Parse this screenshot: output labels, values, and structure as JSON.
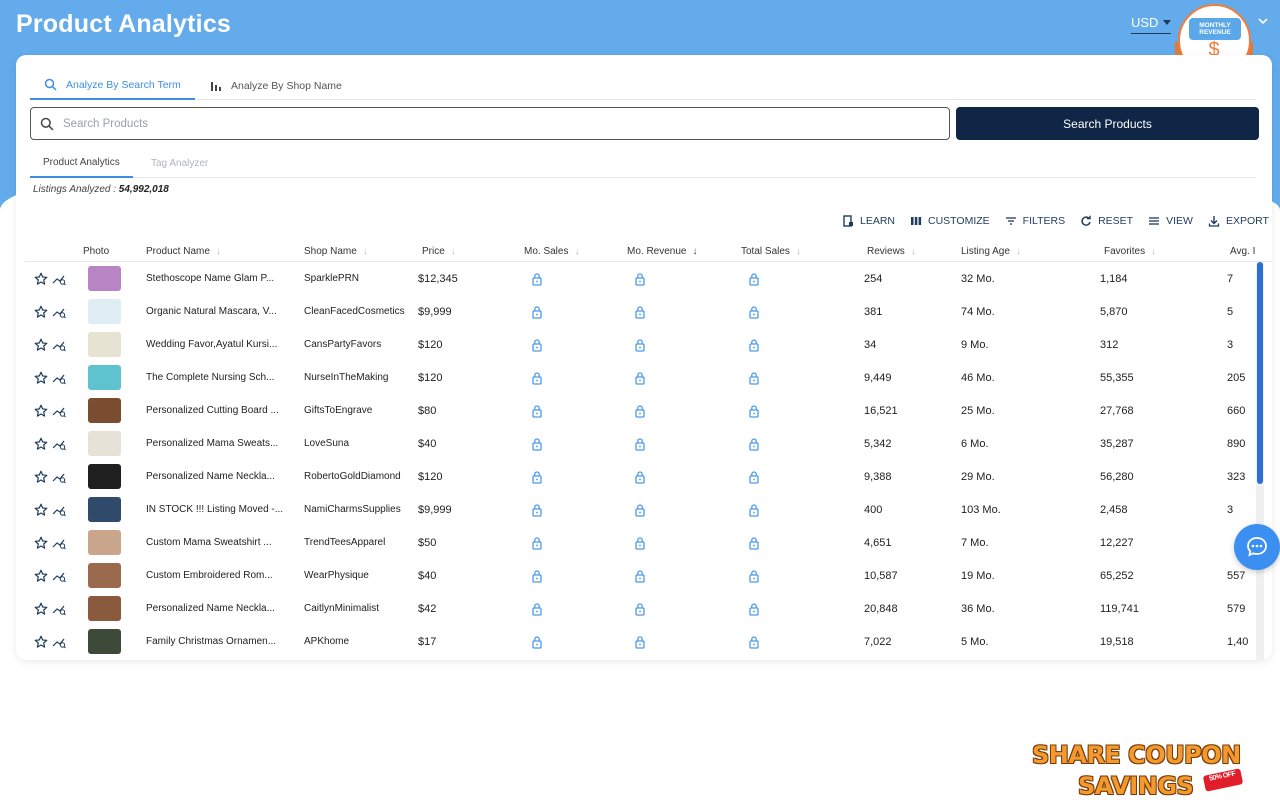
{
  "header": {
    "title": "Product Analytics",
    "currency": "USD",
    "promo_label": "MONTHLY REVENUE",
    "promo_symbol": "$"
  },
  "mode_tabs": [
    {
      "label": "Analyze By Search Term",
      "icon": "search-icon",
      "active": true
    },
    {
      "label": "Analyze By Shop Name",
      "icon": "bar-chart-icon",
      "active": false
    }
  ],
  "search": {
    "placeholder": "Search Products",
    "value": "",
    "button_label": "Search Products"
  },
  "sub_tabs": [
    {
      "label": "Product Analytics",
      "active": true
    },
    {
      "label": "Tag Analyzer",
      "active": false
    }
  ],
  "listings": {
    "label": "Listings Analyzed :",
    "count": "54,992,018"
  },
  "toolbar": {
    "learn": "LEARN",
    "customize": "CUSTOMIZE",
    "filters": "FILTERS",
    "reset": "RESET",
    "view": "VIEW",
    "export": "EXPORT"
  },
  "columns": {
    "photo": "Photo",
    "product_name": "Product Name",
    "shop_name": "Shop Name",
    "price": "Price",
    "mo_sales": "Mo. Sales",
    "mo_revenue": "Mo. Revenue",
    "total_sales": "Total Sales",
    "reviews": "Reviews",
    "listing_age": "Listing Age",
    "favorites": "Favorites",
    "avg": "Avg. I"
  },
  "rows": [
    {
      "product": "Stethoscope Name Glam P...",
      "shop": "SparklePRN",
      "price": "$12,345",
      "reviews": "254",
      "age": "32 Mo.",
      "favorites": "1,184",
      "avg": "7",
      "photo_color": "#b884c4"
    },
    {
      "product": "Organic Natural Mascara, V...",
      "shop": "CleanFacedCosmetics",
      "price": "$9,999",
      "reviews": "381",
      "age": "74 Mo.",
      "favorites": "5,870",
      "avg": "5",
      "photo_color": "#dfeef5"
    },
    {
      "product": "Wedding Favor,Ayatul Kursi...",
      "shop": "CansPartyFavors",
      "price": "$120",
      "reviews": "34",
      "age": "9 Mo.",
      "favorites": "312",
      "avg": "3",
      "photo_color": "#e6e3d3"
    },
    {
      "product": "The Complete Nursing Sch...",
      "shop": "NurseInTheMaking",
      "price": "$120",
      "reviews": "9,449",
      "age": "46 Mo.",
      "favorites": "55,355",
      "avg": "205",
      "photo_color": "#5fc3cf"
    },
    {
      "product": "Personalized Cutting Board ...",
      "shop": "GiftsToEngrave",
      "price": "$80",
      "reviews": "16,521",
      "age": "25 Mo.",
      "favorites": "27,768",
      "avg": "660",
      "photo_color": "#7a4d31"
    },
    {
      "product": "Personalized Mama Sweats...",
      "shop": "LoveSuna",
      "price": "$40",
      "reviews": "5,342",
      "age": "6 Mo.",
      "favorites": "35,287",
      "avg": "890",
      "photo_color": "#e7e2d8"
    },
    {
      "product": "Personalized Name Neckla...",
      "shop": "RobertoGoldDiamond",
      "price": "$120",
      "reviews": "9,388",
      "age": "29 Mo.",
      "favorites": "56,280",
      "avg": "323",
      "photo_color": "#1f1f1f"
    },
    {
      "product": "IN STOCK !!! Listing Moved -...",
      "shop": "NamiCharmsSupplies",
      "price": "$9,999",
      "reviews": "400",
      "age": "103 Mo.",
      "favorites": "2,458",
      "avg": "3",
      "photo_color": "#2f4a6a"
    },
    {
      "product": "Custom Mama Sweatshirt ...",
      "shop": "TrendTeesApparel",
      "price": "$50",
      "reviews": "4,651",
      "age": "7 Mo.",
      "favorites": "12,227",
      "avg": "",
      "photo_color": "#c9a68c"
    },
    {
      "product": "Custom Embroidered Rom...",
      "shop": "WearPhysique",
      "price": "$40",
      "reviews": "10,587",
      "age": "19 Mo.",
      "favorites": "65,252",
      "avg": "557",
      "photo_color": "#9b6a4e"
    },
    {
      "product": "Personalized Name Neckla...",
      "shop": "CaitlynMinimalist",
      "price": "$42",
      "reviews": "20,848",
      "age": "36 Mo.",
      "favorites": "119,741",
      "avg": "579",
      "photo_color": "#8a5a3e"
    },
    {
      "product": "Family Christmas Ornamen...",
      "shop": "APKhome",
      "price": "$17",
      "reviews": "7,022",
      "age": "5 Mo.",
      "favorites": "19,518",
      "avg": "1,40",
      "photo_color": "#3d4a3a"
    }
  ],
  "coupon": {
    "line1": "SHARE COUPON",
    "line2": "SAVINGS",
    "tag": "50% OFF"
  },
  "colors": {
    "header_bg": "#63abeb",
    "primary": "#0f2647",
    "accent": "#3d8ee4",
    "lock": "#4c9be8"
  }
}
